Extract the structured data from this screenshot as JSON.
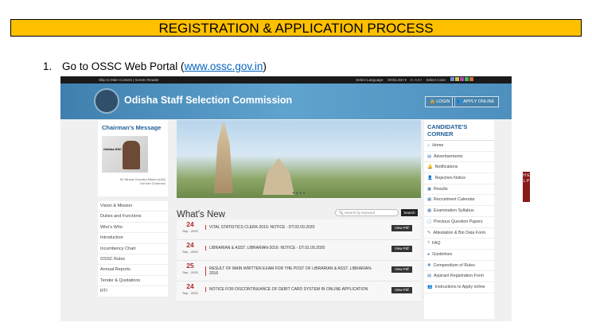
{
  "banner": "REGISTRATION & APPLICATION PROCESS",
  "step": {
    "number": "1.",
    "text": "Go to OSSC Web Portal (",
    "link": "www.ossc.gov.in",
    "close": ")"
  },
  "site": {
    "top_left": "Skip to Main Content | Screen Reader",
    "language_label": "Select Language:",
    "language_value": "ENGLISH ▾",
    "font_controls": "A-   A   A+",
    "color_label": "Select Color",
    "swatches": [
      "#6a8fd0",
      "#d0c04a",
      "#b04ab0",
      "#4ab06a",
      "#d07040"
    ],
    "title": "Odisha Staff Selection Commission",
    "login": "🔒 LOGIN",
    "apply": "👥 APPLY ONLINE",
    "chairman_title": "Chairman's Message",
    "chairman_plate": "Odisha SSC",
    "chairman_name": "Sri Nirmal Chandra Mishra (IAS)",
    "chairman_role": "Hon'ble Chairman",
    "left_menu": [
      "Vision & Mission",
      "Duties and Functions",
      "Who's Who",
      "Introduction",
      "Incumbency Chart",
      "OSSC Rules",
      "Annual Reports",
      "Tender & Quotations",
      "RTI"
    ],
    "slider_dots": "● ● ● ●",
    "whats_new": "What's New",
    "search_placeholder": "🔍 Search by keyword",
    "search_button": "Search",
    "news": [
      {
        "day": "24",
        "month": "Sep - 2020",
        "text": "VITAL STATISTICS CLERK-2016: NOTICE - DT.02.09.2020",
        "btn": "View Pdf"
      },
      {
        "day": "24",
        "month": "Sep - 2020",
        "text": "LIBRARIAN & ASST. LIBRARIAN-2016: NOTICE - DT.01.09.2020",
        "btn": "View Pdf"
      },
      {
        "day": "25",
        "month": "Sep - 2020",
        "text": "RESULT OF MAIN WRITTEN EXAM FOR THE POST OF LIBRARIAN & ASST. LIBRARIAN-2016",
        "btn": "View Pdf"
      },
      {
        "day": "24",
        "month": "Sep - 2020",
        "text": "NOTICE FOR DISCONTINUANCE OF DEBIT CARD SYSTEM IN ONLINE APPLICATION",
        "btn": "View Pdf"
      }
    ],
    "corner_title": "CANDIDATE'S CORNER",
    "corner_items": [
      {
        "icon": "⌂",
        "label": "Home"
      },
      {
        "icon": "▤",
        "label": "Advertisements"
      },
      {
        "icon": "🔔",
        "label": "Notifications"
      },
      {
        "icon": "👤",
        "label": "Rejection Notice"
      },
      {
        "icon": "▣",
        "label": "Results"
      },
      {
        "icon": "▦",
        "label": "Recruitment Calendar"
      },
      {
        "icon": "▦",
        "label": "Examination Syllabus"
      },
      {
        "icon": "▢",
        "label": "Previous Question Papers"
      },
      {
        "icon": "✎",
        "label": "Attestation & Bio Data Form"
      },
      {
        "icon": "?",
        "label": "FAQ"
      },
      {
        "icon": "●",
        "label": "Guidelines"
      },
      {
        "icon": "✚",
        "label": "Compendium of Rules"
      },
      {
        "icon": "▤",
        "label": "Aspirant Registration Form"
      },
      {
        "icon": "👥",
        "label": "Instructions to Apply online"
      }
    ],
    "help": "H E L P"
  }
}
